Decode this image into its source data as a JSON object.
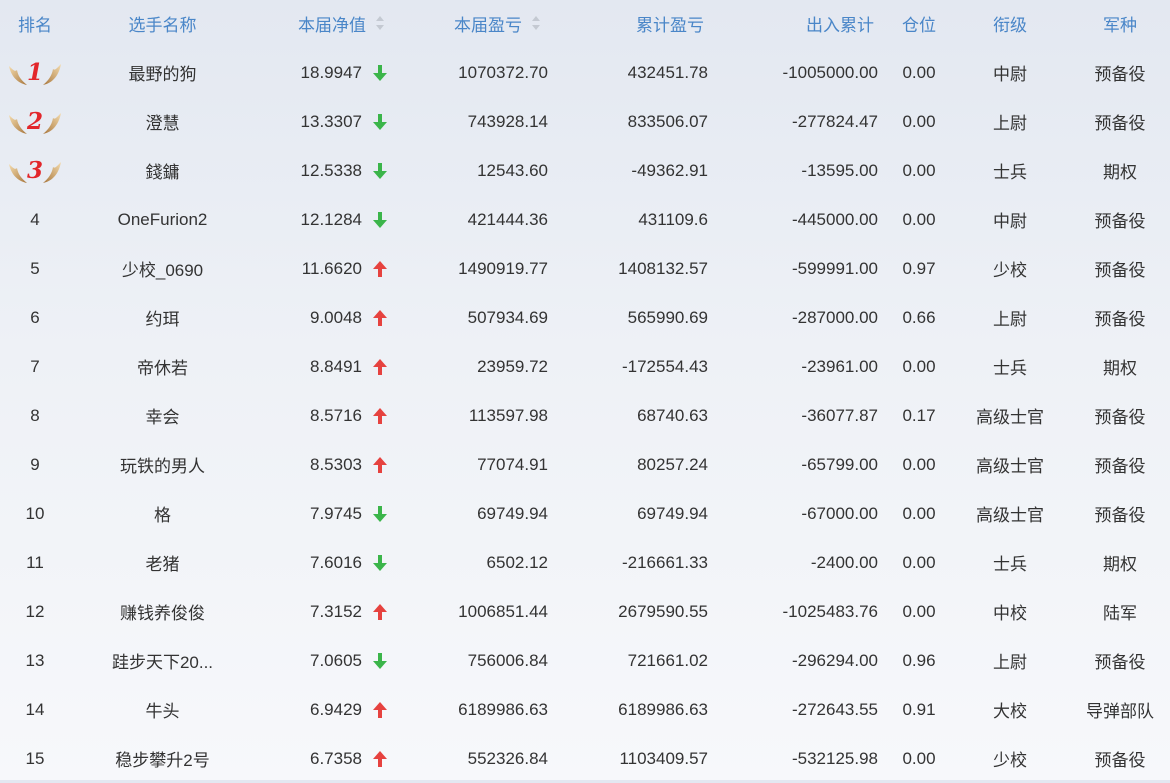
{
  "headers": {
    "rank": "排名",
    "name": "选手名称",
    "nav": "本届净值",
    "pnl": "本届盈亏",
    "cum_pnl": "累计盈亏",
    "flow": "出入累计",
    "position": "仓位",
    "grade": "衔级",
    "arm": "军种"
  },
  "colors": {
    "header_text": "#4a86c8",
    "up_arrow": "#e6423f",
    "down_arrow": "#3bb54a",
    "medal_number": "#e2262b"
  },
  "rows": [
    {
      "rank": "1",
      "medal": true,
      "name": "最野的狗",
      "nav": "18.9947",
      "trend": "down",
      "pnl": "1070372.70",
      "cum_pnl": "432451.78",
      "flow": "-1005000.00",
      "position": "0.00",
      "grade": "中尉",
      "arm": "预备役"
    },
    {
      "rank": "2",
      "medal": true,
      "name": "澄慧",
      "nav": "13.3307",
      "trend": "down",
      "pnl": "743928.14",
      "cum_pnl": "833506.07",
      "flow": "-277824.47",
      "position": "0.00",
      "grade": "上尉",
      "arm": "预备役"
    },
    {
      "rank": "3",
      "medal": true,
      "name": "錢鏞",
      "nav": "12.5338",
      "trend": "down",
      "pnl": "12543.60",
      "cum_pnl": "-49362.91",
      "flow": "-13595.00",
      "position": "0.00",
      "grade": "士兵",
      "arm": "期权"
    },
    {
      "rank": "4",
      "medal": false,
      "name": "OneFurion2",
      "nav": "12.1284",
      "trend": "down",
      "pnl": "421444.36",
      "cum_pnl": "431109.6",
      "flow": "-445000.00",
      "position": "0.00",
      "grade": "中尉",
      "arm": "预备役"
    },
    {
      "rank": "5",
      "medal": false,
      "name": "少校_0690",
      "nav": "11.6620",
      "trend": "up",
      "pnl": "1490919.77",
      "cum_pnl": "1408132.57",
      "flow": "-599991.00",
      "position": "0.97",
      "grade": "少校",
      "arm": "预备役"
    },
    {
      "rank": "6",
      "medal": false,
      "name": "约珥",
      "nav": "9.0048",
      "trend": "up",
      "pnl": "507934.69",
      "cum_pnl": "565990.69",
      "flow": "-287000.00",
      "position": "0.66",
      "grade": "上尉",
      "arm": "预备役"
    },
    {
      "rank": "7",
      "medal": false,
      "name": "帝休若",
      "nav": "8.8491",
      "trend": "up",
      "pnl": "23959.72",
      "cum_pnl": "-172554.43",
      "flow": "-23961.00",
      "position": "0.00",
      "grade": "士兵",
      "arm": "期权"
    },
    {
      "rank": "8",
      "medal": false,
      "name": "幸会",
      "nav": "8.5716",
      "trend": "up",
      "pnl": "113597.98",
      "cum_pnl": "68740.63",
      "flow": "-36077.87",
      "position": "0.17",
      "grade": "高级士官",
      "arm": "预备役"
    },
    {
      "rank": "9",
      "medal": false,
      "name": "玩铁的男人",
      "nav": "8.5303",
      "trend": "up",
      "pnl": "77074.91",
      "cum_pnl": "80257.24",
      "flow": "-65799.00",
      "position": "0.00",
      "grade": "高级士官",
      "arm": "预备役"
    },
    {
      "rank": "10",
      "medal": false,
      "name": "格",
      "nav": "7.9745",
      "trend": "down",
      "pnl": "69749.94",
      "cum_pnl": "69749.94",
      "flow": "-67000.00",
      "position": "0.00",
      "grade": "高级士官",
      "arm": "预备役"
    },
    {
      "rank": "11",
      "medal": false,
      "name": "老猪",
      "nav": "7.6016",
      "trend": "down",
      "pnl": "6502.12",
      "cum_pnl": "-216661.33",
      "flow": "-2400.00",
      "position": "0.00",
      "grade": "士兵",
      "arm": "期权"
    },
    {
      "rank": "12",
      "medal": false,
      "name": "赚钱养俊俊",
      "nav": "7.3152",
      "trend": "up",
      "pnl": "1006851.44",
      "cum_pnl": "2679590.55",
      "flow": "-1025483.76",
      "position": "0.00",
      "grade": "中校",
      "arm": "陆军"
    },
    {
      "rank": "13",
      "medal": false,
      "name": "跬步天下20...",
      "nav": "7.0605",
      "trend": "down",
      "pnl": "756006.84",
      "cum_pnl": "721661.02",
      "flow": "-296294.00",
      "position": "0.96",
      "grade": "上尉",
      "arm": "预备役"
    },
    {
      "rank": "14",
      "medal": false,
      "name": "牛头",
      "nav": "6.9429",
      "trend": "up",
      "pnl": "6189986.63",
      "cum_pnl": "6189986.63",
      "flow": "-272643.55",
      "position": "0.91",
      "grade": "大校",
      "arm": "导弹部队"
    },
    {
      "rank": "15",
      "medal": false,
      "name": "稳步攀升2号",
      "nav": "6.7358",
      "trend": "up",
      "pnl": "552326.84",
      "cum_pnl": "1103409.57",
      "flow": "-532125.98",
      "position": "0.00",
      "grade": "少校",
      "arm": "预备役"
    }
  ]
}
